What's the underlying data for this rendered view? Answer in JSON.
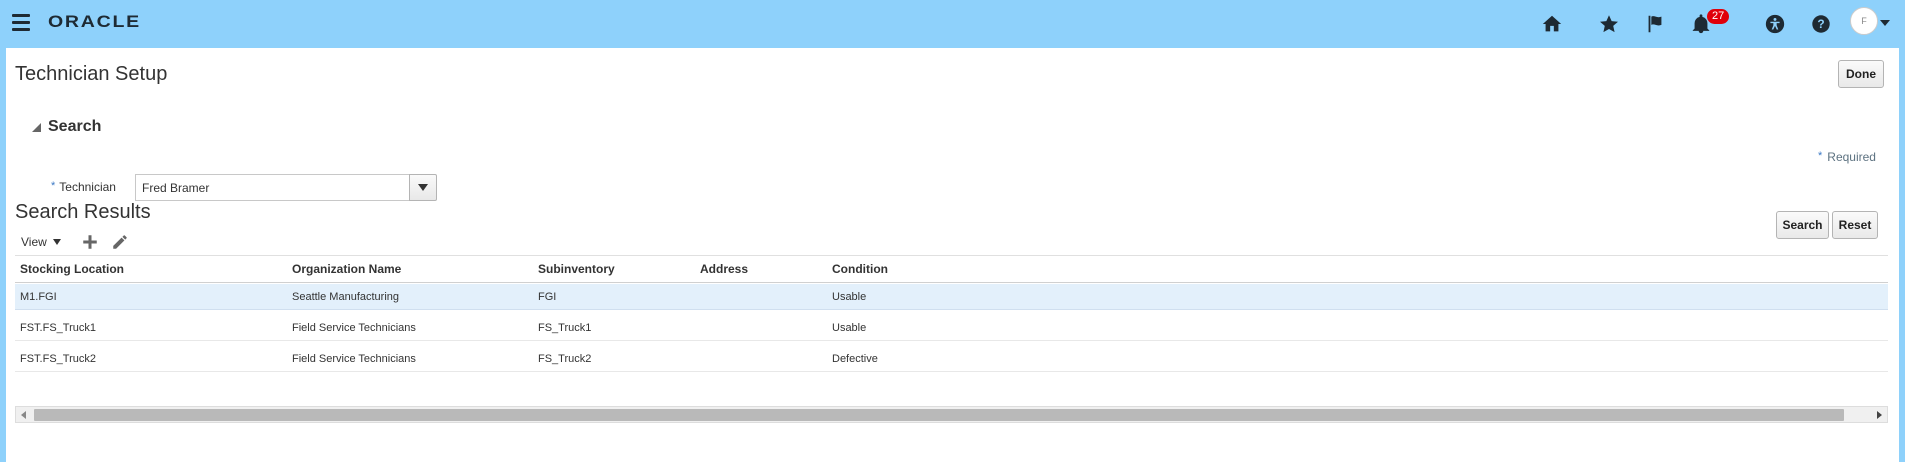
{
  "header": {
    "logo": "ORACLE",
    "notification_count": "27",
    "avatar_text": "F"
  },
  "page": {
    "title": "Technician Setup",
    "done_label": "Done"
  },
  "search": {
    "section_title": "Search",
    "required_star": "*",
    "required_label": "Required",
    "technician_label": "Technician",
    "technician_value": "Fred Bramer",
    "search_button": "Search",
    "reset_button": "Reset"
  },
  "results": {
    "title": "Search Results",
    "view_label": "View",
    "columns": [
      "Stocking Location",
      "Organization Name",
      "Subinventory",
      "Address",
      "Condition"
    ],
    "rows": [
      [
        "M1.FGI",
        "Seattle Manufacturing",
        "FGI",
        "",
        "Usable"
      ],
      [
        "FST.FS_Truck1",
        "Field Service Technicians",
        "FS_Truck1",
        "",
        "Usable"
      ],
      [
        "FST.FS_Truck2",
        "Field Service Technicians",
        "FS_Truck2",
        "",
        "Defective"
      ]
    ]
  },
  "icons": {
    "menu": "hamburger-menu-icon",
    "home": "home-icon",
    "favorites": "star-icon",
    "flag": "flag-icon",
    "notifications": "bell-icon",
    "accessibility": "accessibility-icon",
    "help": "help-icon",
    "add": "plus-icon",
    "edit": "pencil-icon"
  },
  "colors": {
    "header_bg": "#8ed1fb",
    "selected_row": "#e3f0fb",
    "badge": "#e0000a"
  }
}
